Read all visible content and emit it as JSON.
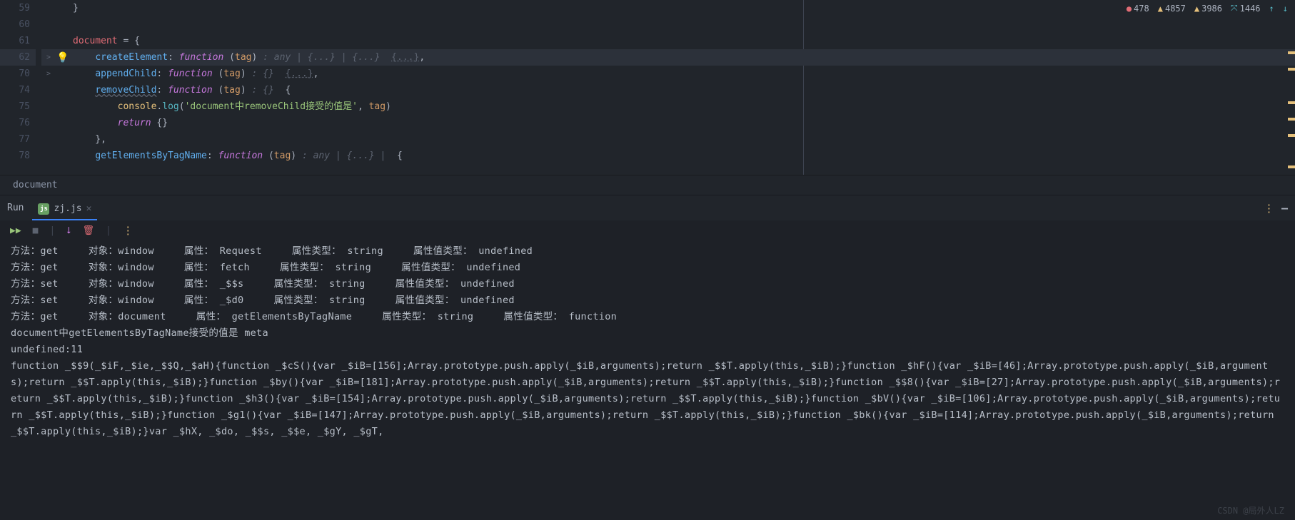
{
  "editor": {
    "lines": [
      {
        "num": "59",
        "fold": "",
        "bulb": "",
        "hl": false,
        "tokens": [
          {
            "cls": "tk-plain",
            "t": "}"
          }
        ]
      },
      {
        "num": "60",
        "fold": "",
        "bulb": "",
        "hl": false,
        "tokens": []
      },
      {
        "num": "61",
        "fold": "",
        "bulb": "",
        "hl": false,
        "tokens": [
          {
            "cls": "tk-var",
            "t": "document"
          },
          {
            "cls": "tk-plain",
            "t": " = {"
          }
        ]
      },
      {
        "num": "62",
        "fold": ">",
        "bulb": "💡",
        "hl": true,
        "tokens": [
          {
            "cls": "tk-plain",
            "t": "    "
          },
          {
            "cls": "tk-prop",
            "t": "createElement"
          },
          {
            "cls": "tk-plain",
            "t": ": "
          },
          {
            "cls": "tk-func",
            "t": "function"
          },
          {
            "cls": "tk-plain",
            "t": " ("
          },
          {
            "cls": "tk-param",
            "t": "tag"
          },
          {
            "cls": "tk-plain",
            "t": ") "
          },
          {
            "cls": "tk-hint",
            "t": ": any | {...} | {...}"
          },
          {
            "cls": "tk-plain",
            "t": "  "
          },
          {
            "cls": "tk-fold",
            "t": "{...}"
          },
          {
            "cls": "tk-plain",
            "t": ","
          }
        ]
      },
      {
        "num": "70",
        "fold": ">",
        "bulb": "",
        "hl": false,
        "tokens": [
          {
            "cls": "tk-plain",
            "t": "    "
          },
          {
            "cls": "tk-prop",
            "t": "appendChild"
          },
          {
            "cls": "tk-plain",
            "t": ": "
          },
          {
            "cls": "tk-func",
            "t": "function"
          },
          {
            "cls": "tk-plain",
            "t": " ("
          },
          {
            "cls": "tk-param",
            "t": "tag"
          },
          {
            "cls": "tk-plain",
            "t": ") "
          },
          {
            "cls": "tk-hint",
            "t": ": {}"
          },
          {
            "cls": "tk-plain",
            "t": "  "
          },
          {
            "cls": "tk-fold",
            "t": "{...}"
          },
          {
            "cls": "tk-plain",
            "t": ","
          }
        ]
      },
      {
        "num": "74",
        "fold": "",
        "bulb": "",
        "hl": false,
        "tokens": [
          {
            "cls": "tk-plain",
            "t": "    "
          },
          {
            "cls": "tk-prop-u",
            "t": "removeChild"
          },
          {
            "cls": "tk-plain",
            "t": ": "
          },
          {
            "cls": "tk-func",
            "t": "function"
          },
          {
            "cls": "tk-plain",
            "t": " ("
          },
          {
            "cls": "tk-param",
            "t": "tag"
          },
          {
            "cls": "tk-plain",
            "t": ") "
          },
          {
            "cls": "tk-hint",
            "t": ": {}"
          },
          {
            "cls": "tk-plain",
            "t": "  {"
          }
        ]
      },
      {
        "num": "75",
        "fold": "",
        "bulb": "",
        "hl": false,
        "tokens": [
          {
            "cls": "tk-plain",
            "t": "        "
          },
          {
            "cls": "tk-obj",
            "t": "console"
          },
          {
            "cls": "tk-plain",
            "t": "."
          },
          {
            "cls": "tk-meth",
            "t": "log"
          },
          {
            "cls": "tk-plain",
            "t": "("
          },
          {
            "cls": "tk-str",
            "t": "'document中removeChild接受的值是'"
          },
          {
            "cls": "tk-plain",
            "t": ", "
          },
          {
            "cls": "tk-param",
            "t": "tag"
          },
          {
            "cls": "tk-plain",
            "t": ")"
          }
        ]
      },
      {
        "num": "76",
        "fold": "",
        "bulb": "",
        "hl": false,
        "tokens": [
          {
            "cls": "tk-plain",
            "t": "        "
          },
          {
            "cls": "tk-kw",
            "t": "return"
          },
          {
            "cls": "tk-plain",
            "t": " {}"
          }
        ]
      },
      {
        "num": "77",
        "fold": "",
        "bulb": "",
        "hl": false,
        "tokens": [
          {
            "cls": "tk-plain",
            "t": "    },"
          }
        ]
      },
      {
        "num": "78",
        "fold": "",
        "bulb": "",
        "hl": false,
        "tokens": [
          {
            "cls": "tk-plain",
            "t": "    "
          },
          {
            "cls": "tk-prop",
            "t": "getElementsByTagName"
          },
          {
            "cls": "tk-plain",
            "t": ": "
          },
          {
            "cls": "tk-func",
            "t": "function"
          },
          {
            "cls": "tk-plain",
            "t": " ("
          },
          {
            "cls": "tk-param",
            "t": "tag"
          },
          {
            "cls": "tk-plain",
            "t": ") "
          },
          {
            "cls": "tk-hint",
            "t": ": any | {...} |"
          },
          {
            "cls": "tk-plain",
            "t": "  {"
          }
        ]
      }
    ]
  },
  "status": {
    "errors": "478",
    "warn1": "4857",
    "warn2": "3986",
    "info": "1446"
  },
  "breadcrumb": "document",
  "run": {
    "label": "Run",
    "tab_name": "zj.js"
  },
  "console": {
    "lines": [
      "方法：get     对象：window     属性： Request     属性类型： string     属性值类型： undefined",
      "方法：get     对象：window     属性： fetch     属性类型： string     属性值类型： undefined",
      "方法：set     对象：window     属性： _$$s     属性类型： string     属性值类型： undefined",
      "方法：set     对象：window     属性： _$d0     属性类型： string     属性值类型： undefined",
      "方法：get     对象：document     属性： getElementsByTagName     属性类型： string     属性值类型： function",
      "document中getElementsByTagName接受的值是 meta",
      "undefined:11"
    ],
    "wrap": "function _$$9(_$iF,_$ie,_$$Q,_$aH){function _$cS(){var _$iB=[156];Array.prototype.push.apply(_$iB,arguments);return _$$T.apply(this,_$iB);}function _$hF(){var _$iB=[46];Array.prototype.push.apply(_$iB,arguments);return _$$T.apply(this,_$iB);}function _$by(){var _$iB=[181];Array.prototype.push.apply(_$iB,arguments);return _$$T.apply(this,_$iB);}function _$$8(){var _$iB=[27];Array.prototype.push.apply(_$iB,arguments);return _$$T.apply(this,_$iB);}function _$h3(){var _$iB=[154];Array.prototype.push.apply(_$iB,arguments);return _$$T.apply(this,_$iB);}function _$bV(){var _$iB=[106];Array.prototype.push.apply(_$iB,arguments);return _$$T.apply(this,_$iB);}function _$g1(){var _$iB=[147];Array.prototype.push.apply(_$iB,arguments);return _$$T.apply(this,_$iB);}function _$bk(){var _$iB=[114];Array.prototype.push.apply(_$iB,arguments);return _$$T.apply(this,_$iB);}var _$hX, _$do, _$$s, _$$e, _$gY, _$gT,"
  },
  "watermark": "CSDN @局外人LZ"
}
